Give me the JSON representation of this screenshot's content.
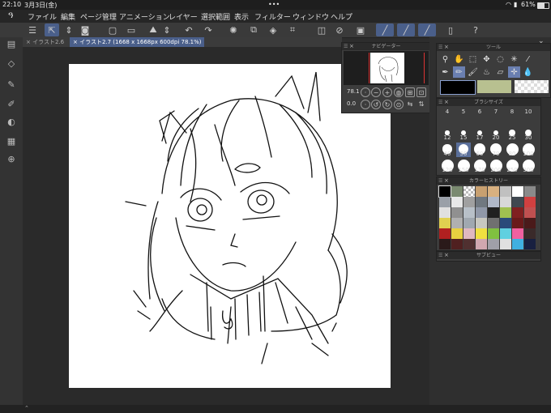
{
  "status": {
    "time": "22:10",
    "date": "3月3日(金)",
    "dots": "•••",
    "battery": "61%"
  },
  "menu": {
    "items": [
      "ファイル",
      "編集",
      "ページ管理",
      "アニメーション",
      "レイヤー",
      "選択範囲",
      "表示",
      "フィルター",
      "ウィンドウ",
      "ヘルプ"
    ]
  },
  "tabs": [
    {
      "label": "イラスト2.6"
    },
    {
      "label": "イラスト2.7 (1668 x 1668px 600dpi 78.1%)"
    }
  ],
  "navigator": {
    "title": "ナビゲーター",
    "zoom": "78.1",
    "rotation": "0.0"
  },
  "tool_panel": {
    "title": "ツール",
    "colors": {
      "main": "#000000",
      "sub": "#b8c090"
    }
  },
  "brush_panel": {
    "title": "ブラシサイズ",
    "sizes": [
      "4",
      "5",
      "6",
      "7",
      "8",
      "10",
      "12",
      "15",
      "17",
      "20",
      "25",
      "30",
      "40",
      "50",
      "60",
      "70",
      "80",
      "100",
      "120",
      "150",
      "170",
      "200",
      "250",
      "300"
    ]
  },
  "history_panel": {
    "title": "カラーヒストリー",
    "colors": [
      "#000000",
      "#7a8a70",
      "checker",
      "#c8a070",
      "#d8b080",
      "#c0c0c0",
      "#ffffff",
      "#8a8a8a",
      "#9aa0a8",
      "#e8e8e8",
      "#a0a0a0",
      "#707880",
      "#b0b8c8",
      "#d8d8d8",
      "#404850",
      "#d04040",
      "#e0e0e0",
      "#909090",
      "#b8c0c8",
      "#9098a8",
      "#202020",
      "#a0c050",
      "#802020",
      "#c05050",
      "#e0d050",
      "#b0b0b0",
      "#a0a8b0",
      "#c8c8c0",
      "#707070",
      "#2a4a7a",
      "#6a1a1a",
      "#4a1a1a",
      "#b02020",
      "#e8d040",
      "#e0b8c0",
      "#f0e040",
      "#80c040",
      "#60d0e0",
      "#f060a0",
      "#3a2a2a",
      "#2a1a1a",
      "#502020",
      "#503030",
      "#d0a8b0",
      "#a0a0a8",
      "#e0e0e0",
      "#40b0e0",
      "#182040"
    ]
  },
  "subview": {
    "title": "サブビュー"
  }
}
